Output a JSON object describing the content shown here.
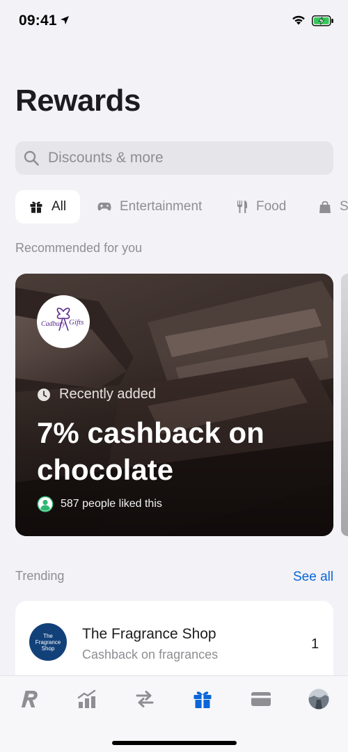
{
  "status_bar": {
    "time": "09:41"
  },
  "page": {
    "title": "Rewards"
  },
  "search": {
    "placeholder": "Discounts & more",
    "value": ""
  },
  "categories": [
    {
      "label": "All",
      "icon": "gift-icon",
      "active": true
    },
    {
      "label": "Entertainment",
      "icon": "gamepad-icon",
      "active": false
    },
    {
      "label": "Food",
      "icon": "fork-knife-icon",
      "active": false
    },
    {
      "label": "S",
      "icon": "shopping-bag-icon",
      "active": false
    }
  ],
  "recommended": {
    "section_label": "Recommended for you",
    "card": {
      "logo_text": [
        "Cadbury",
        "Gifts"
      ],
      "badge": "Recently added",
      "title": "7% cashback on chocolate",
      "likes": "587 people liked this"
    }
  },
  "trending": {
    "section_label": "Trending",
    "see_all": "See all",
    "items": [
      {
        "logo_text": "The Fragrance Shop",
        "name": "The Fragrance Shop",
        "subtitle": "Cashback on fragrances",
        "rank": "1"
      }
    ]
  },
  "tab_bar": {
    "accent": "#0a66d8",
    "inactive": "#8e8e93",
    "tabs": [
      {
        "icon": "revolut-logo-icon",
        "active": false
      },
      {
        "icon": "chart-icon",
        "active": false
      },
      {
        "icon": "transfer-arrows-icon",
        "active": false
      },
      {
        "icon": "gift-icon",
        "active": true
      },
      {
        "icon": "card-icon",
        "active": false
      },
      {
        "icon": "avatar",
        "active": false
      }
    ]
  }
}
